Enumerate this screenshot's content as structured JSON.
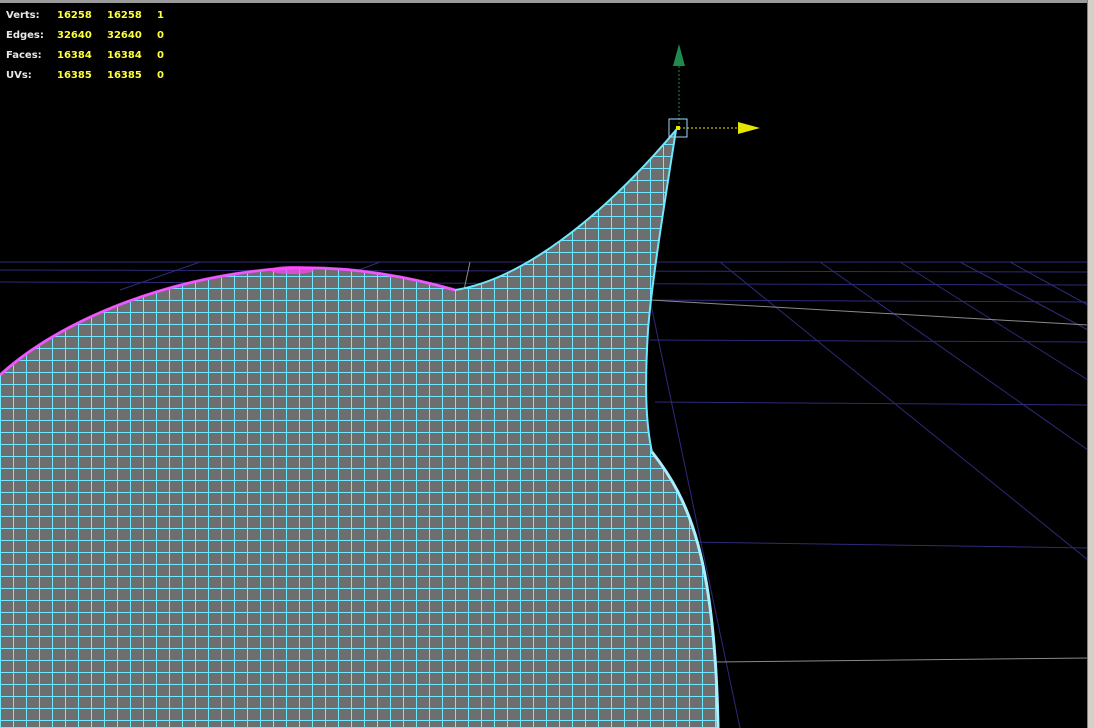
{
  "hud": {
    "rows": [
      {
        "label": "Verts:",
        "total": "16258",
        "visible": "16258",
        "selected": "1"
      },
      {
        "label": "Edges:",
        "total": "32640",
        "visible": "32640",
        "selected": "0"
      },
      {
        "label": "Faces:",
        "total": "16384",
        "visible": "16384",
        "selected": "0"
      },
      {
        "label": "UVs:",
        "total": "16385",
        "visible": "16385",
        "selected": "0"
      }
    ]
  },
  "colors": {
    "background": "#000000",
    "mesh_fill": "#6e6e6e",
    "wireframe": "#6ee8ff",
    "pole_highlight": "#ff44ff",
    "grid": "#2e2a7a",
    "grid_axis": "#8a8a8a",
    "hud_label": "#e8e8e8",
    "hud_value": "#ffff3a",
    "manipulator_y": "#1f8a4c",
    "manipulator_x": "#e6e600",
    "selection_box": "#9ad8ff"
  },
  "icons": {
    "move_manipulator": "move-manipulator-icon",
    "y_axis_handle": "arrow-up-icon",
    "x_axis_handle": "arrow-right-icon"
  }
}
